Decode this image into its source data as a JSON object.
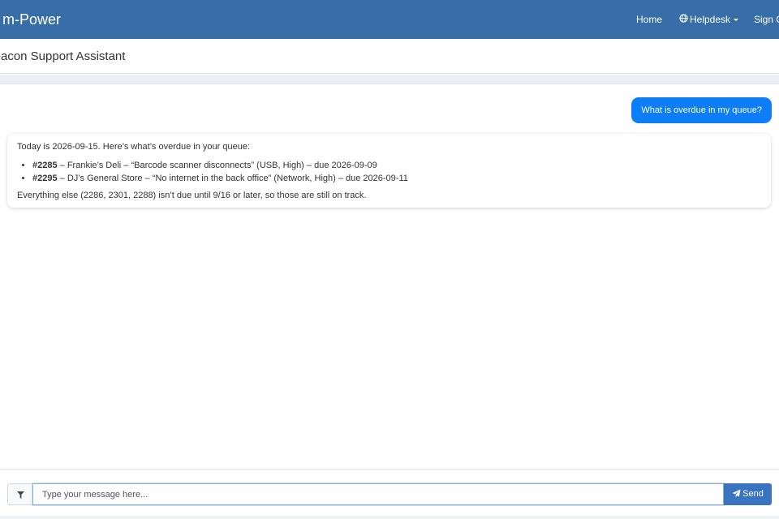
{
  "navbar": {
    "brand": "m-Power",
    "links": {
      "home": "Home",
      "helpdesk": "Helpdesk",
      "signout": "Sign Out"
    },
    "icons": {
      "helpdesk": "globe-icon",
      "helpdesk_dropdown": "caret-down-icon"
    }
  },
  "page": {
    "title": "Beacon Support Assistant"
  },
  "chat": {
    "user_message": "What is overdue in my queue?",
    "bot": {
      "intro": "Today is 2026-09-15. Here’s what’s overdue in your queue:",
      "items": [
        {
          "id": "#2285",
          "text": " – Frankie’s Deli – “Barcode scanner disconnects” (USB, High) – due 2026-09-09"
        },
        {
          "id": "#2295",
          "text": " – DJ’s General Store – “No internet in the back office” (Network, High) – due 2026-09-11"
        }
      ],
      "outro": "Everything else (2286, 2301, 2288) isn’t due until 9/16 or later, so those are still on track."
    }
  },
  "composer": {
    "placeholder": "Type your message here...",
    "value": "",
    "send_label": "Send",
    "icons": {
      "filter": "filter-icon",
      "send": "paper-plane-icon"
    }
  },
  "colors": {
    "navbar": "#376ea8",
    "user_bubble": "#0d7ef8",
    "send_button": "#3a73bf"
  }
}
